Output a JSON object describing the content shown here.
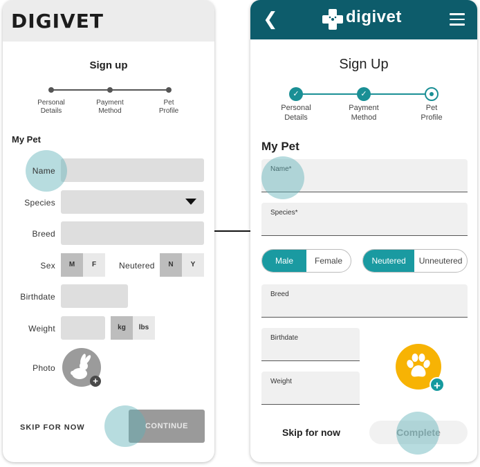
{
  "wireframe": {
    "brand": "DIGIVET",
    "title": "Sign up",
    "steps": [
      "Personal\nDetails",
      "Payment\nMethod",
      "Pet\nProfile"
    ],
    "section": "My Pet",
    "labels": {
      "name": "Name",
      "species": "Species",
      "breed": "Breed",
      "sex": "Sex",
      "neutered": "Neutered",
      "birthdate": "Birthdate",
      "weight": "Weight",
      "photo": "Photo"
    },
    "sex_options": [
      "M",
      "F"
    ],
    "neutered_options": [
      "N",
      "Y"
    ],
    "weight_units": [
      "kg",
      "lbs"
    ],
    "skip": "SKIP FOR NOW",
    "continue": "CONTINUE"
  },
  "app": {
    "brand": "digivet",
    "title": "Sign Up",
    "steps": [
      "Personal\nDetails",
      "Payment\nMethod",
      "Pet\nProfile"
    ],
    "section": "My Pet",
    "fields": {
      "name": "Name*",
      "species": "Species*",
      "breed": "Breed",
      "birthdate": "Birthdate",
      "weight": "Weight"
    },
    "sex_options": [
      "Male",
      "Female"
    ],
    "neutered_options": [
      "Neutered",
      "Unneutered"
    ],
    "skip": "Skip for now",
    "complete": "Complete"
  },
  "colors": {
    "header": "#0d5c6b",
    "accent": "#1a9aa1",
    "paw": "#f7b304",
    "tap": "#5fb2b8"
  }
}
